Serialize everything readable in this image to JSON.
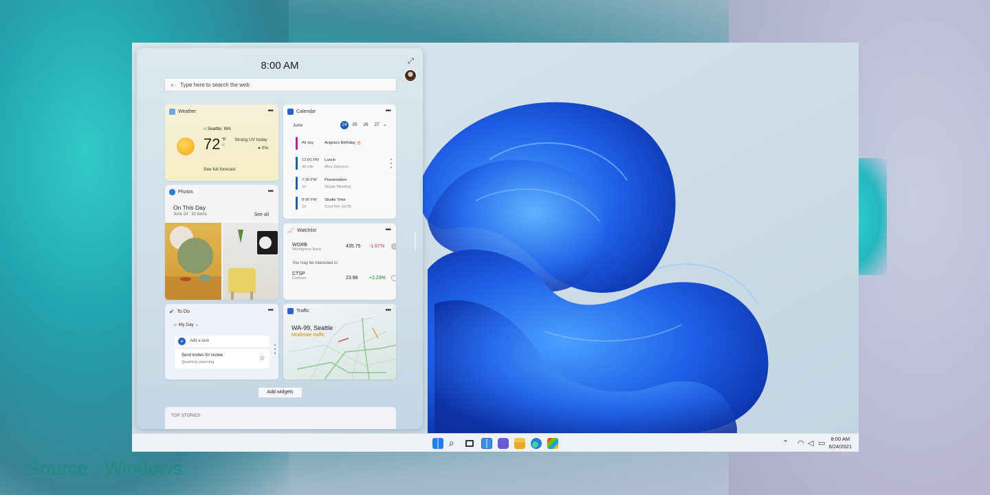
{
  "caption": {
    "source": "Source : Windows"
  },
  "widgets": {
    "time": "8:00 AM",
    "search": {
      "placeholder": "Type here to search the web"
    },
    "weather": {
      "title": "Weather",
      "location": "Seattle, WA",
      "temperature": "72",
      "unit": "°F",
      "unit_alt": "°C",
      "condition": "Strong UV today",
      "precip": "0%",
      "link": "See full forecast"
    },
    "photos": {
      "title": "Photos",
      "heading": "On This Day",
      "date": "June 24",
      "count": "33 items",
      "see_all": "See all"
    },
    "todo": {
      "title": "To Do",
      "list": "My Day",
      "add_task": "Add a task",
      "task_title": "Send invites for review",
      "task_sub": "Quarterly planning"
    },
    "calendar": {
      "title": "Calendar",
      "month": "June",
      "days": [
        "24",
        "25",
        "26",
        "27"
      ],
      "events": [
        {
          "time": "All day",
          "duration": "",
          "title": "Angela's Birthday 🎂",
          "sub": "",
          "color": "#c0208f"
        },
        {
          "time": "12:00 PM",
          "duration": "30 min",
          "title": "Lunch",
          "sub": "Alex Johnson",
          "color": "#1a5fb4"
        },
        {
          "time": "7:30 PM",
          "duration": "1h",
          "title": "Presentation",
          "sub": "Skype Meeting",
          "color": "#1a5fb4"
        },
        {
          "time": "8:00 PM",
          "duration": "1h",
          "title": "Studio Time",
          "sub": "Conf Rm 32/35",
          "color": "#1a5fb4"
        }
      ]
    },
    "watchlist": {
      "title": "Watchlist",
      "rows": [
        {
          "symbol": "WGRB",
          "name": "Woodgrove Bank",
          "price": "435.75",
          "change": "-1.67%",
          "color": "#d13438"
        },
        {
          "symbol": "CTSP",
          "name": "Contoso",
          "price": "23.98",
          "change": "+2.23%",
          "color": "#107c10"
        }
      ],
      "suggest": "You may be interested in"
    },
    "traffic": {
      "title": "Traffic",
      "road": "WA-99, Seattle",
      "status": "Moderate traffic"
    },
    "add_widgets": "Add widgets",
    "top_stories": "TOP STORIES"
  },
  "taskbar": {
    "time": "8:00 AM",
    "date": "6/24/2021"
  }
}
